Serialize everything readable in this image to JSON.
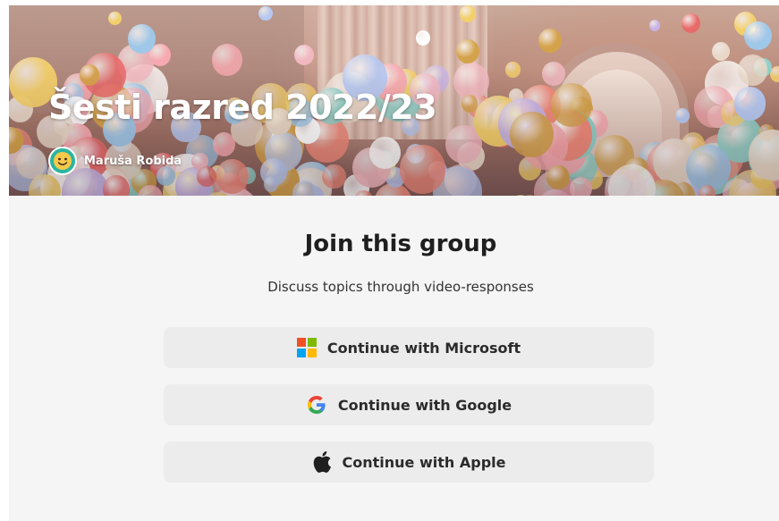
{
  "group": {
    "title": "Šesti razred 2022/23",
    "owner_name": "Maruša Robida",
    "owner_avatar_icon": "smiley-avatar-icon"
  },
  "join": {
    "heading": "Join this group",
    "subheading": "Discuss topics through video-responses"
  },
  "auth_buttons": {
    "microsoft": {
      "label": "Continue with Microsoft",
      "icon": "microsoft-logo-icon"
    },
    "google": {
      "label": "Continue with Google",
      "icon": "google-logo-icon"
    },
    "apple": {
      "label": "Continue with Apple",
      "icon": "apple-logo-icon"
    }
  },
  "colors": {
    "page_bg": "#f5f5f5",
    "button_bg": "#ececec",
    "heading_text": "#1f1f1f",
    "avatar_bg": "#2cb5a0"
  }
}
